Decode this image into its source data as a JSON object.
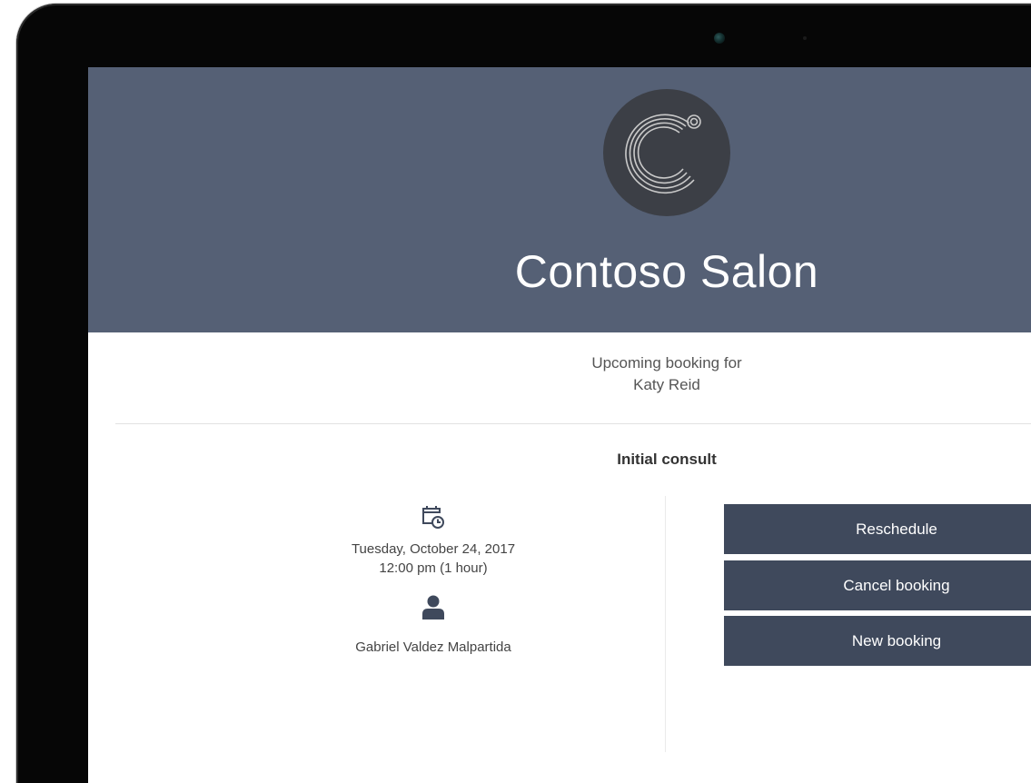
{
  "header": {
    "brand_name": "Contoso Salon",
    "logo_icon": "contoso-c-logo-icon",
    "banner_color": "#556075"
  },
  "booking": {
    "upcoming_label": "Upcoming booking for",
    "customer_name": "Katy Reid",
    "service_name": "Initial consult",
    "date": "Tuesday, October 24, 2017",
    "time": "12:00 pm (1 hour)",
    "staff_name": "Gabriel Valdez Malpartida",
    "date_icon": "calendar-clock-icon",
    "staff_icon": "person-icon"
  },
  "actions": {
    "reschedule_label": "Reschedule",
    "cancel_label": "Cancel booking",
    "new_label": "New booking",
    "button_color": "#3f495c"
  }
}
